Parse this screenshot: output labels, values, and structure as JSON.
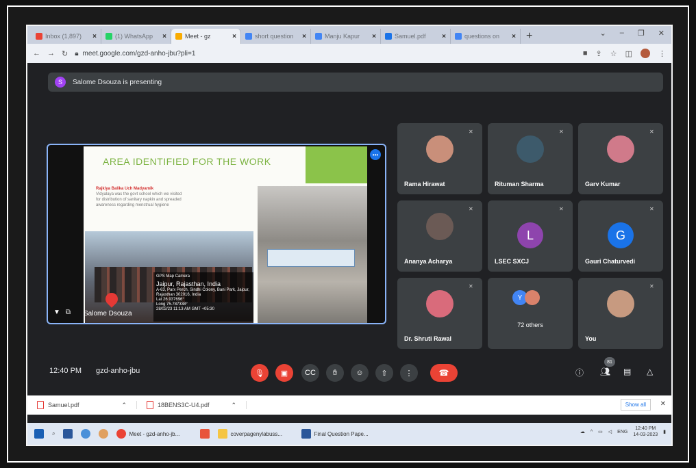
{
  "browser": {
    "tabs": [
      {
        "label": "Inbox (1,897)",
        "color": "#ea4335",
        "active": false
      },
      {
        "label": "(1) WhatsApp",
        "color": "#25d366",
        "active": false
      },
      {
        "label": "Meet - gz",
        "color": "#f9ab00",
        "active": true
      },
      {
        "label": "short question",
        "color": "#4285f4",
        "active": false
      },
      {
        "label": "Manju Kapur",
        "color": "#4285f4",
        "active": false
      },
      {
        "label": "Samuel.pdf",
        "color": "#1a73e8",
        "active": false
      },
      {
        "label": "questions on",
        "color": "#4285f4",
        "active": false
      }
    ],
    "new_tab": "+",
    "url": "meet.google.com/gzd-anho-jbu?pli=1"
  },
  "meet": {
    "presenting_initial": "S",
    "presenting_text": "Salome Dsouza is presenting",
    "slide": {
      "title": "AREA IDENTIFIED FOR THE WORK",
      "bullet_head": "Rajkiya Balika Uch Madyamik",
      "bullet_text": "Vidyalaya was the govt school which we visited for distribution of sanitary napkin and spreaded awareness regarding menstrual hygiene",
      "gps_label": "GPS Map Camera",
      "gps_city": "Jaipur, Rajasthan, India",
      "gps_addr": "A-63, Parx Perch, Sindhi Colony, Bani Park, Jaipur, Rajasthan 302016, India",
      "gps_lat": "Lat 26.937696°",
      "gps_long": "Long 75.787338°",
      "gps_time": "28/02/23 11:13 AM GMT +05:30"
    },
    "presenter_name": "Salome Dsouza",
    "participants": [
      {
        "name": "Rama Hirawat",
        "type": "photo",
        "color": "#c98f7a"
      },
      {
        "name": "Rituman Sharma",
        "type": "photo",
        "color": "#3d5a6b"
      },
      {
        "name": "Garv Kumar",
        "type": "photo",
        "color": "#d07a8a"
      },
      {
        "name": "Ananya Acharya",
        "type": "photo",
        "color": "#6b5a55"
      },
      {
        "name": "LSEC SXCJ",
        "type": "letter",
        "letter": "L",
        "color": "#8e44ad"
      },
      {
        "name": "Gauri Chaturvedi",
        "type": "letter",
        "letter": "G",
        "color": "#1a73e8"
      },
      {
        "name": "Dr. Shruti Rawal",
        "type": "photo",
        "color": "#d96b7b"
      },
      {
        "name": "",
        "type": "others",
        "label": "72 others",
        "letter": "Y"
      },
      {
        "name": "You",
        "type": "photo",
        "color": "#c79a80"
      }
    ],
    "time": "12:40 PM",
    "code": "gzd-anho-jbu",
    "people_count": "81"
  },
  "downloads": {
    "items": [
      "Samuel.pdf",
      "18BENS3C-U4.pdf"
    ],
    "show_all": "Show all"
  },
  "taskbar": {
    "apps": [
      "Meet - gzd-anho-jb...",
      "coverpagenylabuss...",
      "Final Question Pape..."
    ],
    "lang": "ENG",
    "time": "12:40 PM",
    "date": "14-03-2023"
  }
}
